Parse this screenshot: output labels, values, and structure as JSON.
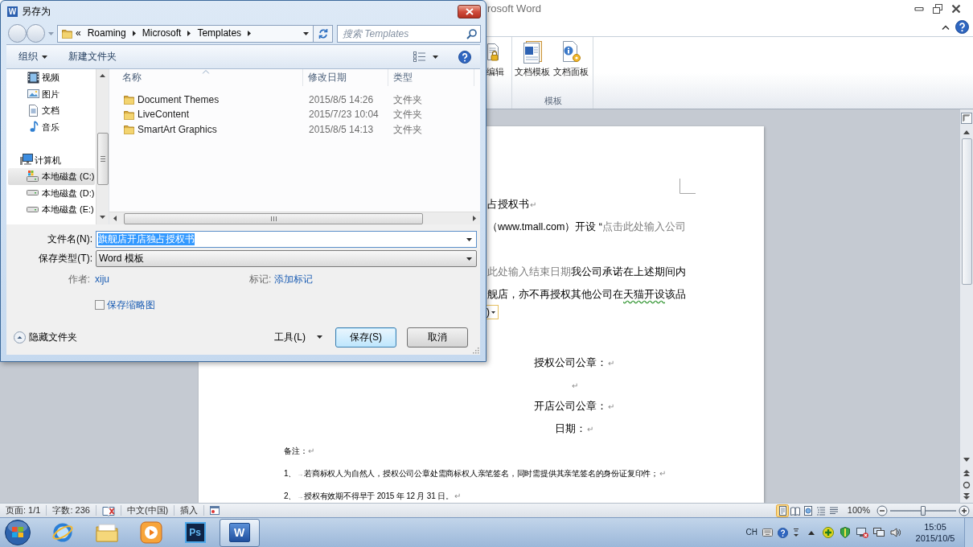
{
  "word_window": {
    "title": "rosoft Word"
  },
  "ribbon": {
    "groups": [
      {
        "buttons": [
          {
            "label": "编辑"
          }
        ]
      },
      {
        "label": "模板",
        "buttons": [
          {
            "label": "文档模板"
          },
          {
            "label": "文档面板"
          }
        ]
      }
    ]
  },
  "save_dialog": {
    "title": "另存为",
    "icon_letter": "W",
    "address": {
      "overflow": "«",
      "path": [
        "Roaming",
        "Microsoft",
        "Templates"
      ]
    },
    "search": {
      "placeholder": "搜索 Templates"
    },
    "toolbar": {
      "organize": "组织",
      "new_folder": "新建文件夹"
    },
    "nav": {
      "libraries": [
        {
          "kind": "video",
          "label": "视频",
          "selected": false
        },
        {
          "kind": "pictures",
          "label": "图片",
          "selected": false
        },
        {
          "kind": "documents",
          "label": "文档",
          "selected": false
        },
        {
          "kind": "music",
          "label": "音乐",
          "selected": false
        }
      ],
      "computer": {
        "label": "计算机",
        "selected": false,
        "children": [
          {
            "kind": "system-drive",
            "label": "本地磁盘 (C:)",
            "selected": true
          },
          {
            "kind": "drive",
            "label": "本地磁盘 (D:)",
            "selected": false
          },
          {
            "kind": "drive",
            "label": "本地磁盘 (E:)",
            "selected": false
          }
        ]
      }
    },
    "files": {
      "columns": [
        {
          "label": "名称",
          "sorted": true
        },
        {
          "label": "修改日期",
          "sorted": false
        },
        {
          "label": "类型",
          "sorted": false
        }
      ],
      "rows": [
        {
          "name": "Document Themes",
          "modified": "2015/8/5 14:26",
          "type": "文件夹"
        },
        {
          "name": "LiveContent",
          "modified": "2015/7/23 10:04",
          "type": "文件夹"
        },
        {
          "name": "SmartArt Graphics",
          "modified": "2015/8/5 14:13",
          "type": "文件夹"
        }
      ]
    },
    "form": {
      "filename": {
        "label": "文件名(N):",
        "value": "旗舰店开店独占授权书",
        "value_selected": true
      },
      "filetype": {
        "label": "保存类型(T):",
        "value": "Word 模板"
      },
      "author": {
        "label": "作者:",
        "value": "xiju"
      },
      "tags": {
        "label": "标记:",
        "value": "添加标记"
      },
      "thumbnail": {
        "label": "保存缩略图",
        "checked": false
      }
    },
    "footer": {
      "hide_folders": "隐藏文件夹",
      "tools": "工具(L)",
      "buttons": [
        {
          "label": "保存(S)",
          "default": true
        },
        {
          "label": "取消",
          "default": false
        }
      ]
    }
  },
  "document": {
    "paragraphs": [
      {
        "kind": "fragment",
        "segments": [
          {
            "kind": "text",
            "text": "占授权书"
          }
        ],
        "mark": "↵"
      },
      {
        "kind": "fragment",
        "segments": [
          {
            "kind": "text",
            "text": "（www.tmall.com）开设 “"
          },
          {
            "kind": "placeholder",
            "text": "点击此处输入公司"
          }
        ]
      },
      {
        "kind": "fragment",
        "segments": [
          {
            "kind": "placeholder",
            "text": "此处输入结束日期"
          },
          {
            "kind": "text",
            "text": "我公司承诺在上述期间内"
          }
        ]
      },
      {
        "kind": "fragment",
        "segments": [
          {
            "kind": "text",
            "text": "舰店，亦不再授权其他公司在"
          },
          {
            "kind": "grammar",
            "text": "天猫开设"
          },
          {
            "kind": "text",
            "text": "该品"
          }
        ]
      },
      {
        "kind": "control",
        "text": ")"
      },
      {
        "kind": "signature",
        "segments": [
          {
            "kind": "text",
            "text": "授权公司公章："
          }
        ],
        "mark": "↵"
      },
      {
        "kind": "signature",
        "mark": "↵"
      },
      {
        "kind": "signature",
        "segments": [
          {
            "kind": "text",
            "text": "开店公司公章："
          }
        ],
        "mark": "↵"
      },
      {
        "kind": "signature",
        "segments": [
          {
            "kind": "text",
            "text": "日期："
          }
        ],
        "mark": "↵"
      },
      {
        "kind": "note",
        "segments": [
          {
            "kind": "text",
            "text": "备注："
          }
        ],
        "mark": "↵"
      },
      {
        "kind": "note",
        "number": "1、",
        "tab": "→",
        "segments": [
          {
            "kind": "text",
            "text": "若商标权人为自然人，授权公司公章处需商标权人亲笔签名，同时需提供其亲笔签名的身份证复印件；"
          }
        ],
        "mark": "↵"
      },
      {
        "kind": "note",
        "number": "2、",
        "tab": "→",
        "segments": [
          {
            "kind": "text",
            "text": "授权有效期不得早于 2015 年 12 月 31 日。"
          }
        ],
        "mark": "↵"
      }
    ]
  },
  "status_bar": {
    "page": "页面: 1/1",
    "words": "字数: 236",
    "language": "中文(中国)",
    "mode": "插入",
    "views": [
      {
        "selected": true
      },
      {
        "selected": false
      },
      {
        "selected": false
      },
      {
        "selected": false
      },
      {
        "selected": false
      }
    ],
    "zoom": {
      "label": "100%",
      "level": 0.5
    }
  },
  "taskbar": {
    "apps": [
      {
        "kind": "browser",
        "active": false
      },
      {
        "kind": "folders",
        "active": false
      },
      {
        "kind": "media",
        "active": false
      },
      {
        "kind": "photoshop",
        "label": "Ps",
        "active": false
      },
      {
        "kind": "word",
        "label": "W",
        "active": true
      }
    ],
    "tray": {
      "language": "CH",
      "time": "15:05",
      "date": "2015/10/5"
    }
  }
}
